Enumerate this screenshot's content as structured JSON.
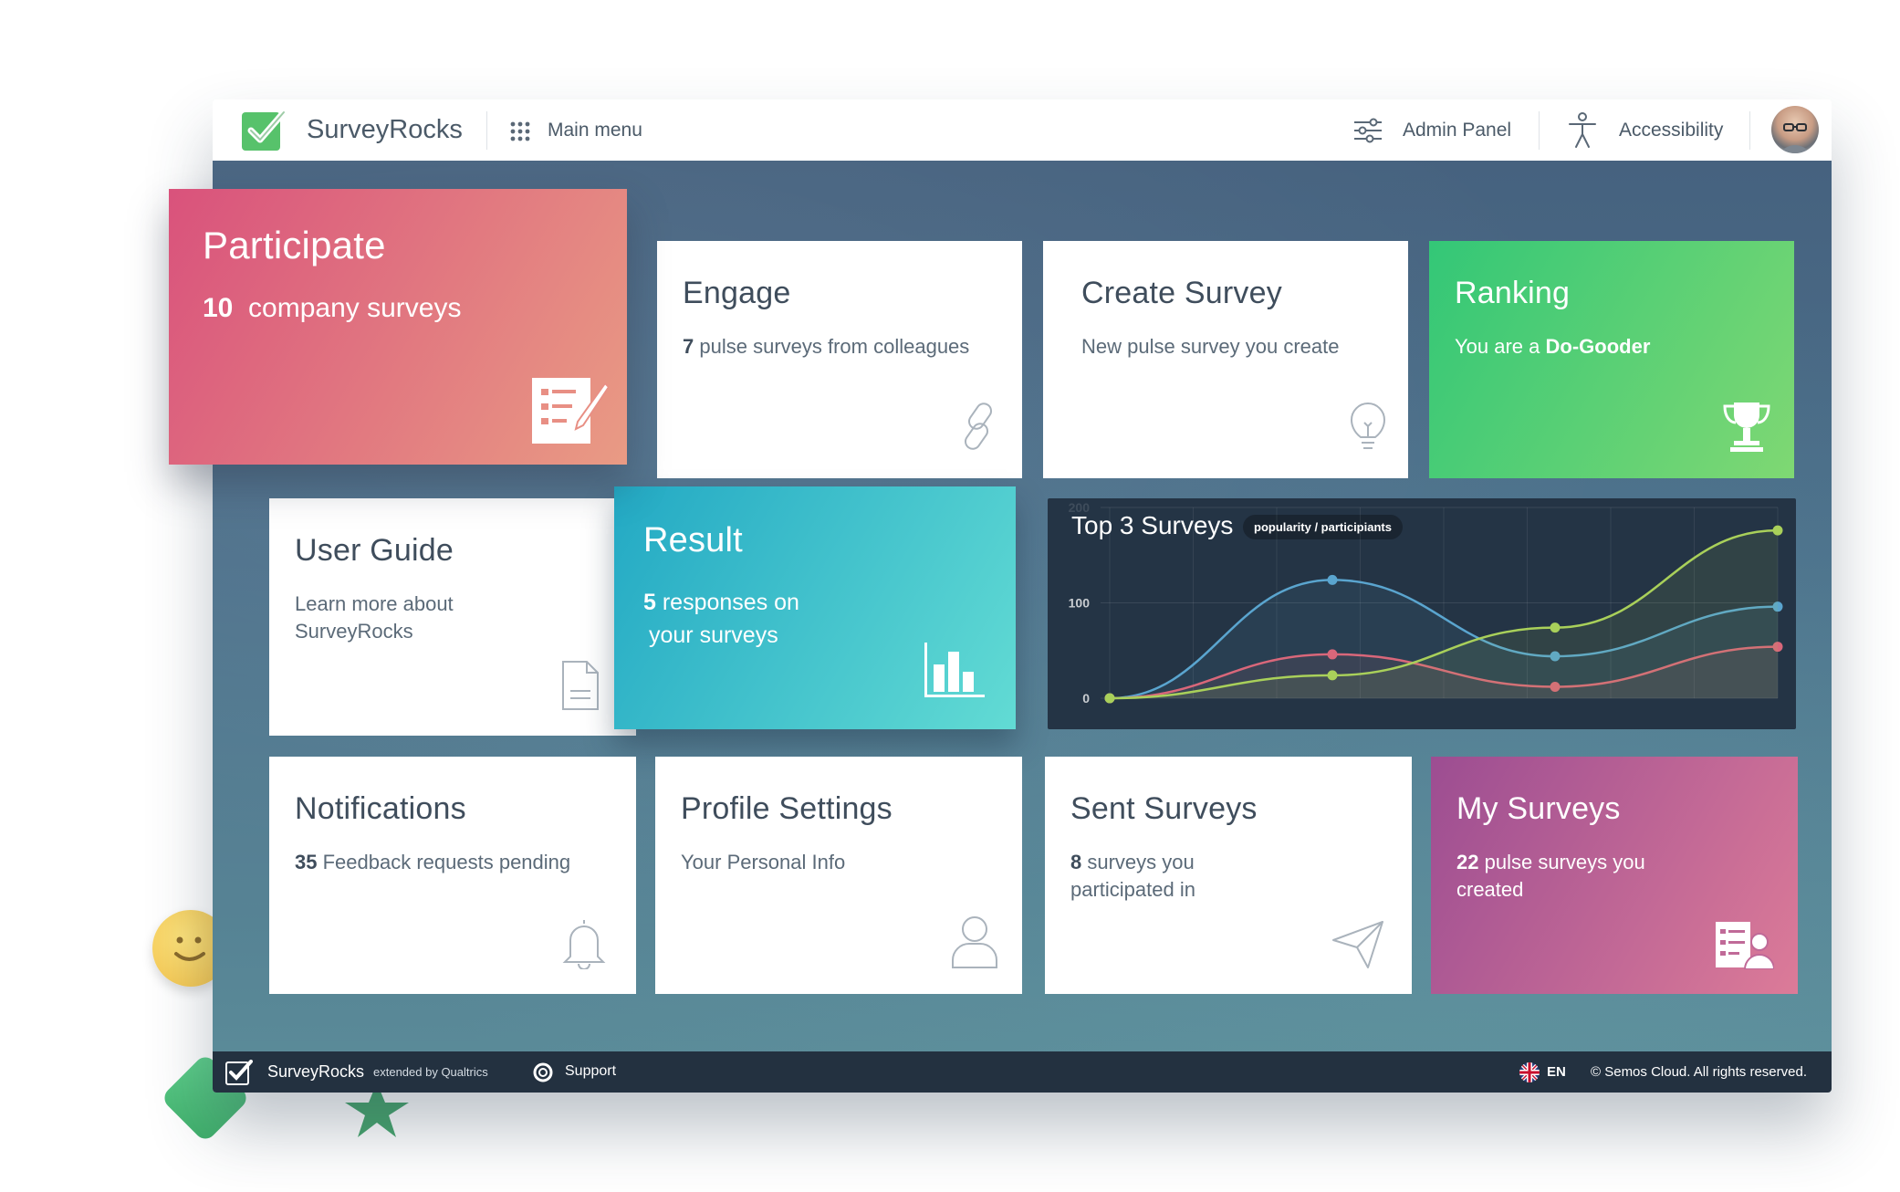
{
  "header": {
    "brand": "SurveyRocks",
    "main_menu": "Main menu",
    "admin_panel": "Admin Panel",
    "accessibility": "Accessibility"
  },
  "tiles": {
    "participate": {
      "title": "Participate",
      "count": "10",
      "text": "company surveys"
    },
    "engage": {
      "title": "Engage",
      "count": "7",
      "text": "pulse surveys from colleagues"
    },
    "create_survey": {
      "title": "Create Survey",
      "text": "New pulse survey you create"
    },
    "ranking": {
      "title": "Ranking",
      "text": "You are a",
      "highlight": "Do-Gooder"
    },
    "user_guide": {
      "title": "User Guide",
      "text": "Learn more about SurveyRocks"
    },
    "result": {
      "title": "Result",
      "count": "5",
      "text": "responses on",
      "text2": "your surveys"
    },
    "notifications": {
      "title": "Notifications",
      "count": "35",
      "text": "Feedback requests pending"
    },
    "profile_settings": {
      "title": "Profile Settings",
      "text": "Your Personal Info"
    },
    "sent_surveys": {
      "title": "Sent Surveys",
      "count": "8",
      "text": "surveys you participated in"
    },
    "my_surveys": {
      "title": "My Surveys",
      "count": "22",
      "text": "pulse surveys you created"
    }
  },
  "chart_data": {
    "type": "line",
    "title": "Top 3 Surveys",
    "badge": "popularity / participiants",
    "y_ticks": [
      "200",
      "100",
      "0"
    ],
    "ylim": [
      0,
      200
    ],
    "x": [
      0,
      1,
      2,
      3
    ],
    "series": [
      {
        "color": "#5aa5cf",
        "values": [
          0,
          124,
          44,
          96
        ]
      },
      {
        "color": "#d9677a",
        "values": [
          0,
          46,
          12,
          54
        ]
      },
      {
        "color": "#a9d05a",
        "values": [
          0,
          24,
          74,
          176
        ]
      }
    ]
  },
  "footer": {
    "brand": "SurveyRocks",
    "extended": "extended by Qualtrics",
    "support": "Support",
    "language": "EN",
    "copyright": "© Semos Cloud. All rights reserved."
  },
  "colors": {
    "participate": [
      "#d9527c",
      "#e99b84"
    ],
    "ranking": [
      "#33c777",
      "#7fd873"
    ],
    "result": [
      "#23a9c4",
      "#62dbd4"
    ],
    "my_surveys": [
      "#9c4d92",
      "#dc7b98"
    ],
    "header_bg": "#ffffff",
    "footer_bg": "#233140"
  }
}
